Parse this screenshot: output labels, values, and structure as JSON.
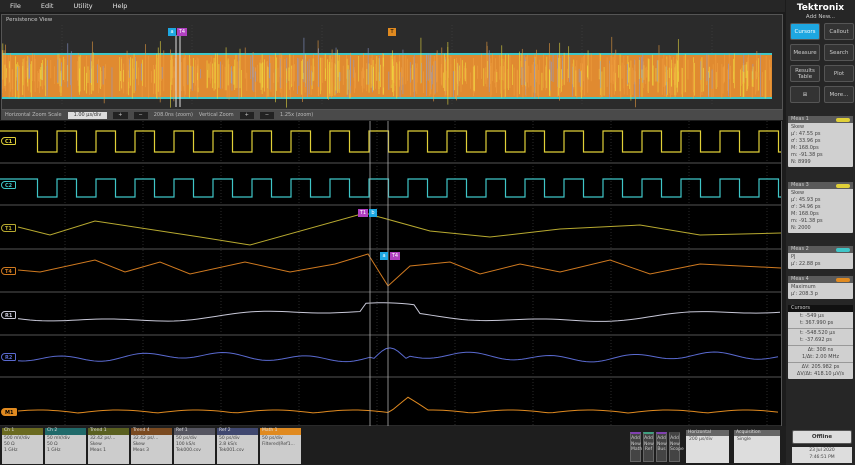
{
  "menu": [
    "File",
    "Edit",
    "Utility",
    "Help"
  ],
  "overview": {
    "title": "Persistence View"
  },
  "zoom": {
    "h_label": "Horizontal Zoom Scale",
    "h_value": "1.00 μs/div",
    "h_info": "208.0ns (zoom)",
    "v_label": "Vertical Zoom",
    "v_info": "1.25x (zoom)",
    "plus": "+",
    "minus": "−"
  },
  "traces": [
    {
      "id": "Ch1",
      "label": "C1",
      "color": "#e0d038"
    },
    {
      "id": "Ch2",
      "label": "C2",
      "color": "#3fc6c8"
    },
    {
      "id": "T1",
      "label": "T1",
      "color": "#b8aa30"
    },
    {
      "id": "T4",
      "label": "T4",
      "color": "#d07a20"
    },
    {
      "id": "R1",
      "label": "R1",
      "color": "#c8c8d8"
    },
    {
      "id": "R2",
      "label": "R2",
      "color": "#5a6ad0"
    },
    {
      "id": "M1",
      "label": "M1",
      "color": "#e08a20"
    }
  ],
  "cursor_markers": {
    "a": "a",
    "b": "b",
    "t1": "T1",
    "t4": "T4",
    "trigger": "T"
  },
  "right": {
    "brand": "Tektronix",
    "add_new": "Add New...",
    "buttons": [
      "Cursors",
      "Callout",
      "Measure",
      "Search",
      "Results Table",
      "Plot",
      "",
      "More..."
    ],
    "active": "Cursors",
    "accent": "#1ea7e1"
  },
  "meas": [
    {
      "title": "Meas 1",
      "lines": [
        "Skew",
        "μ': 47.55 ps",
        "σ': 33.96 ps",
        "M: 168.0ps",
        "m: -91.38 ps",
        "N: 8999"
      ],
      "tag": "#e0d038"
    },
    {
      "title": "Meas 3",
      "lines": [
        "Skew",
        "μ': 45.93 ps",
        "σ': 34.96 ps",
        "M: 168.0ps",
        "m: -91.38 ps",
        "N: 2000"
      ],
      "tag": "#e0d038"
    },
    {
      "title": "Meas 2",
      "lines": [
        "PJ",
        "μ': 22.88 ps"
      ],
      "tag": "#3fc6c8"
    },
    {
      "title": "Meas 4",
      "lines": [
        "Maximum",
        "μ': 208.3 p"
      ],
      "tag": "#e08a20"
    }
  ],
  "cursors": {
    "title": "Cursors",
    "a": [
      "t: -549 μs",
      "t: 367.990 ps"
    ],
    "b": [
      "t: -548.520 μs",
      "t: -37.692 ps"
    ],
    "delta_t": [
      "Δt: 308 ns",
      "1/Δt: 2.00 MHz"
    ],
    "delta_v": [
      "ΔV: 205.982 ps",
      "ΔV/Δt: 418.10 μV/s"
    ]
  },
  "channels": [
    {
      "title": "Ch 1",
      "lines": [
        "500 mV/div",
        "50 Ω",
        "1 GHz"
      ],
      "color": "#6a6a20"
    },
    {
      "title": "Ch 2",
      "lines": [
        "50 mV/div",
        "50 Ω",
        "1 GHz"
      ],
      "color": "#206a6a"
    },
    {
      "title": "Trend 1",
      "lines": [
        "32.42 ps/...",
        "Skew",
        "Meas 1"
      ],
      "color": "#5a6020"
    },
    {
      "title": "Trend 4",
      "lines": [
        "32.42 ps/...",
        "Skew",
        "Meas 3"
      ],
      "color": "#7a4a20"
    },
    {
      "title": "Ref 1",
      "lines": [
        "50 ps/div",
        "100 kS/s",
        "Tek000.csv"
      ],
      "color": "#555560"
    },
    {
      "title": "Ref 2",
      "lines": [
        "50 ps/div",
        "2.8 kS/s",
        "Tek001.csv"
      ],
      "color": "#404870"
    },
    {
      "title": "Math 1",
      "lines": [
        "50 ps/div",
        "Filtered(Ref1..."
      ],
      "color": "#e08a20"
    }
  ],
  "add": [
    [
      "Add",
      "New",
      "Math"
    ],
    [
      "Add",
      "New",
      "Ref"
    ],
    [
      "Add",
      "New",
      "Bus"
    ],
    [
      "Add",
      "New",
      "Scope"
    ]
  ],
  "horizontal": {
    "title": "Horizontal",
    "value": "200 μs/div"
  },
  "acquisition": {
    "title": "Acquisition",
    "value": "Single"
  },
  "offline": "Offline",
  "datetime": [
    "23 Jul 2020",
    "7:46:51 PM"
  ]
}
